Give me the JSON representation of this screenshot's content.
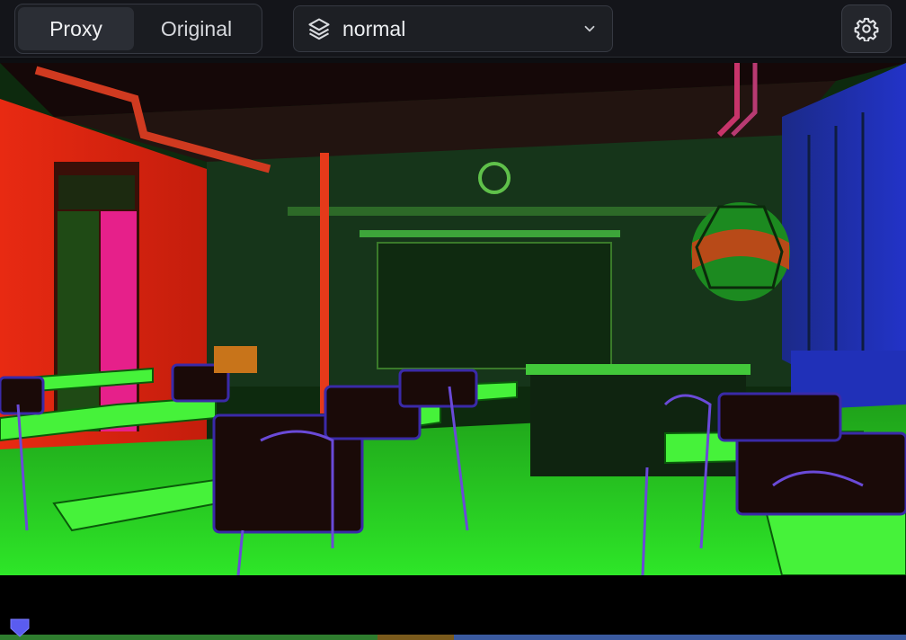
{
  "toolbar": {
    "view_mode": {
      "options": [
        "Proxy",
        "Original"
      ],
      "selected": "Proxy"
    },
    "layer_select": {
      "icon": "layers-icon",
      "value": "normal"
    },
    "settings": {
      "icon": "gear-icon"
    }
  },
  "colors": {
    "accent_playhead": "#5a5cf0",
    "timeline_segments": [
      "#2f7d2f",
      "#7a5a1c",
      "#3a5aa0"
    ]
  }
}
